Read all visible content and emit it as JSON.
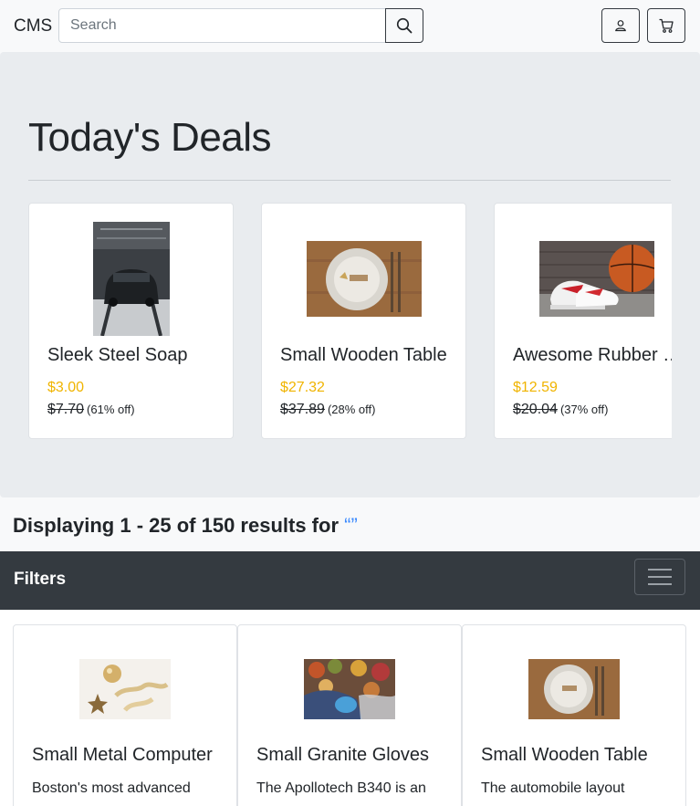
{
  "navbar": {
    "brand": "CMS",
    "search_placeholder": "Search",
    "search_icon": "search-icon",
    "account_icon": "user-icon",
    "cart_icon": "cart-icon"
  },
  "deals": {
    "title": "Today's Deals",
    "items": [
      {
        "name": "Sleek Steel Soap",
        "price": "$3.00",
        "old_price": "$7.70",
        "discount": "(61% off)",
        "image": "sports-car-in-garage"
      },
      {
        "name": "Small Wooden Table",
        "price": "$27.32",
        "old_price": "$37.89",
        "discount": "(28% off)",
        "image": "plate-with-cutlery"
      },
      {
        "name": "Awesome Rubber Shoes",
        "price": "$12.59",
        "old_price": "$20.04",
        "discount": "(37% off)",
        "image": "sneakers-and-basketball"
      }
    ]
  },
  "results": {
    "prefix": "Displaying 1 - 25 of 150 results for",
    "query": "“”"
  },
  "filters": {
    "title": "Filters",
    "toggle_icon": "hamburger-menu-icon"
  },
  "products": [
    {
      "name": "Small Metal Computer",
      "description": "Boston's most advanced",
      "image": "gold-ornaments"
    },
    {
      "name": "Small Granite Gloves",
      "description": "The Apollotech B340 is an",
      "image": "market-produce"
    },
    {
      "name": "Small Wooden Table",
      "description": "The automobile layout",
      "image": "plate-with-cutlery"
    }
  ],
  "colors": {
    "accent_price": "#f0b400",
    "filters_bar": "#343a40",
    "jumbotron": "#e9ecef",
    "query_link": "#3d8bfd"
  }
}
